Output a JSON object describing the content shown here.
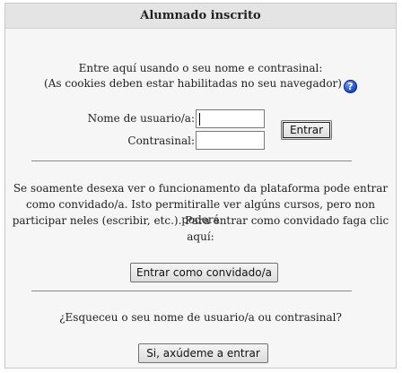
{
  "panel": {
    "title": "Alumnado inscrito"
  },
  "login": {
    "intro_line1": "Entre aquí usando o seu nome e contrasinal:",
    "intro_line2": "(As cookies deben estar habilitadas no seu navegador)",
    "help_icon": "question-mark-circle",
    "username_label": "Nome de usuario/a:",
    "username_value": "",
    "password_label": "Contrasinal:",
    "password_value": "",
    "submit_label": "Entrar"
  },
  "guest": {
    "line1": "Se soamente desexa ver o funcionamento da plataforma pode entrar",
    "line2": "como convidado/a. Isto permitiralle ver algúns cursos, pero non poderá",
    "line3": "participar neles (escribir, etc.). Para entrar como convidado faga clic",
    "line4": "aquí:",
    "button_label": "Entrar como convidado/a"
  },
  "forgot": {
    "question": "¿Esqueceu o seu nome de usuario/a ou contrasinal?",
    "button_label": "Si, axúdeme a entrar"
  },
  "colors": {
    "header_bg": "#e4e4e4",
    "panel_bg": "#f6f6f6",
    "help_icon": "#1d4fd0"
  }
}
